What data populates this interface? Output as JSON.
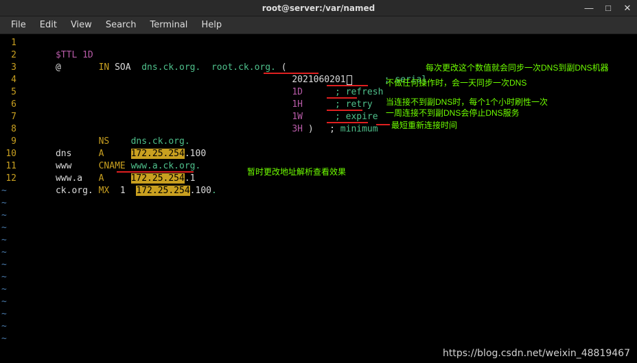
{
  "window": {
    "title": "root@server:/var/named",
    "min": "—",
    "max": "□",
    "close": "✕"
  },
  "menu": {
    "file": "File",
    "edit": "Edit",
    "view": "View",
    "search": "Search",
    "terminal": "Terminal",
    "help": "Help"
  },
  "lines": {
    "n1": "1",
    "n2": "2",
    "n3": "3",
    "n4": "4",
    "n5": "5",
    "n6": "6",
    "n7": "7",
    "n8": "8",
    "n9": "9",
    "n10": "10",
    "n11": "11",
    "n12": "12"
  },
  "code": {
    "l1_ttl": "$TTL ",
    "l1_1d": "1D",
    "l2_at": "@",
    "l2_in": "IN",
    "l2_soa": " SOA  ",
    "l2_dns": "dns.ck.org.",
    "l2_root": "root.ck.org.",
    "l2_paren": " (",
    "l3_serial_val": "2021060201",
    "l3_semi": "; ",
    "l3_serial": "serial",
    "l4_val": "1D",
    "l4_semi": "; ",
    "l4_kw": "refresh",
    "l5_val": "1H",
    "l5_semi": "; ",
    "l5_kw": "retry",
    "l6_val": "1W",
    "l6_semi": "; ",
    "l6_kw": "expire",
    "l7_val": "3H",
    "l7_close": " )   ; ",
    "l7_kw": "minimum",
    "l8_ns": "NS",
    "l8_val": "dns.ck.org.",
    "l9_name": "dns",
    "l9_type": "A",
    "l9_ip_h": "172.25.254",
    "l9_ip_t": ".100",
    "l10_name": "www",
    "l10_type": "CNAME",
    "l10_val": "www.a.ck.org.",
    "l11_name": "www.a",
    "l11_type": "A",
    "l11_ip_h": "172.25.254",
    "l11_ip_t": ".1",
    "l12_name": "ck.org.",
    "l12_type": "MX",
    "l12_pri": "1",
    "l12_ip_h": "172.25.254",
    "l12_ip_t": ".100",
    "l12_dot": "."
  },
  "annot": {
    "a_serial": "每次更改这个数值就会同步一次DNS到副DNS机器",
    "a_refresh": "不做任何操作时，会一天同步一次DNS",
    "a_retry": "当连接不到副DNS时，每个1个小时刷性一次",
    "a_expire": "一周连接不到副DNS会停止DNS服务",
    "a_minimum": "最短重新连接时间",
    "a_temp": "暂时更改地址解析查看效果"
  },
  "watermark": "https://blog.csdn.net/weixin_48819467"
}
